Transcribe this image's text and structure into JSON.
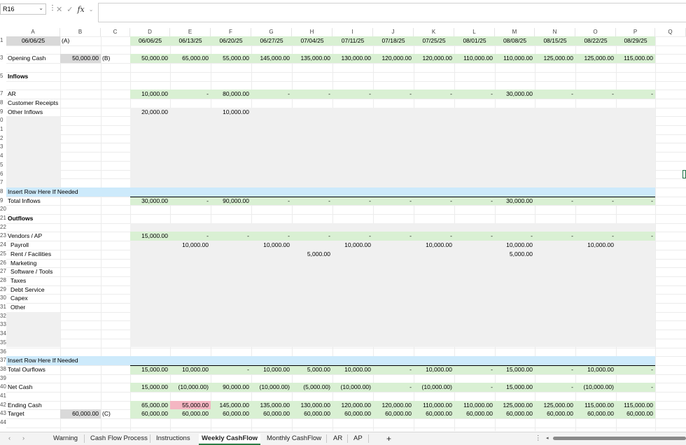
{
  "formula_bar": {
    "name_box": "R16",
    "fx_label": "fx",
    "value": ""
  },
  "columns": [
    "A",
    "B",
    "C",
    "D",
    "E",
    "F",
    "G",
    "H",
    "I",
    "J",
    "K",
    "L",
    "M",
    "N",
    "O",
    "P",
    "Q"
  ],
  "row_numbers": [
    "1",
    "",
    "3",
    "",
    "5",
    "",
    "7",
    "8",
    "9",
    "0",
    "1",
    "2",
    "3",
    "4",
    "5",
    "6",
    "7",
    "8",
    "9",
    "20",
    "21",
    "22",
    "23",
    "24",
    "25",
    "26",
    "27",
    "28",
    "29",
    "30",
    "31",
    "32",
    "33",
    "34",
    "35",
    "36",
    "37",
    "38",
    "39",
    "40",
    "41",
    "42",
    "43",
    "44"
  ],
  "a1": "06/06/25",
  "b1": "(A)",
  "dates": [
    "06/06/25",
    "06/13/25",
    "06/20/25",
    "06/27/25",
    "07/04/25",
    "07/11/25",
    "07/18/25",
    "07/25/25",
    "08/01/25",
    "08/08/25",
    "08/15/25",
    "08/22/25",
    "08/29/25"
  ],
  "opening_cash": {
    "label": "Opening Cash",
    "b": "50,000.00",
    "c": "(B)",
    "values": [
      "50,000.00",
      "65,000.00",
      "55,000.00",
      "145,000.00",
      "135,000.00",
      "130,000.00",
      "120,000.00",
      "120,000.00",
      "110,000.00",
      "110,000.00",
      "125,000.00",
      "125,000.00",
      "115,000.00"
    ]
  },
  "inflows_header": "Inflows",
  "ar": {
    "label": "AR",
    "values": [
      "10,000.00",
      "-",
      "80,000.00",
      "-",
      "-",
      "-",
      "-",
      "-",
      "-",
      "30,000.00",
      "-",
      "-",
      "-"
    ]
  },
  "customer_receipts": {
    "label": "Customer Receipts"
  },
  "other_inflows": {
    "label": "Other Inflows",
    "values": [
      "20,000.00",
      "",
      "10,000.00",
      "",
      "",
      "",
      "",
      "",
      "",
      "",
      "",
      "",
      ""
    ]
  },
  "insert_row_1": "Insert Row Here If Needed",
  "total_inflows": {
    "label": "Total Inflows",
    "values": [
      "30,000.00",
      "-",
      "90,000.00",
      "-",
      "-",
      "-",
      "-",
      "-",
      "-",
      "30,000.00",
      "-",
      "-",
      "-"
    ]
  },
  "outflows_header": "Outflows",
  "vendors": {
    "label": "Vendors / AP",
    "values": [
      "15,000.00",
      "-",
      "-",
      "-",
      "-",
      "-",
      "-",
      "-",
      "-",
      "-",
      "-",
      "-",
      "-"
    ]
  },
  "payroll": {
    "label": "Payroll",
    "values": [
      "",
      "10,000.00",
      "",
      "10,000.00",
      "",
      "10,000.00",
      "",
      "10,000.00",
      "",
      "10,000.00",
      "",
      "10,000.00",
      ""
    ]
  },
  "rent": {
    "label": "Rent / Facilities",
    "values": [
      "",
      "",
      "",
      "",
      "5,000.00",
      "",
      "",
      "",
      "",
      "5,000.00",
      "",
      "",
      ""
    ]
  },
  "outflow_labels": [
    "Marketing",
    "Software / Tools",
    "Taxes",
    "Debt Service",
    "Capex",
    "Other"
  ],
  "insert_row_2": "Insert Row Here If Needed",
  "total_outflows": {
    "label": "Total Ourflows",
    "values": [
      "15,000.00",
      "10,000.00",
      "-",
      "10,000.00",
      "5,000.00",
      "10,000.00",
      "-",
      "10,000.00",
      "-",
      "15,000.00",
      "-",
      "10,000.00",
      "-"
    ]
  },
  "net_cash": {
    "label": "Net Cash",
    "values": [
      "15,000.00",
      "(10,000.00)",
      "90,000.00",
      "(10,000.00)",
      "(5,000.00)",
      "(10,000.00)",
      "-",
      "(10,000.00)",
      "-",
      "15,000.00",
      "-",
      "(10,000.00)",
      "-"
    ]
  },
  "ending_cash": {
    "label": "Ending Cash",
    "values": [
      "65,000.00",
      "55,000.00",
      "145,000.00",
      "135,000.00",
      "130,000.00",
      "120,000.00",
      "120,000.00",
      "110,000.00",
      "110,000.00",
      "125,000.00",
      "125,000.00",
      "115,000.00",
      "115,000.00"
    ]
  },
  "target": {
    "label": "Target",
    "b": "60,000.00",
    "c": "(C)",
    "values": [
      "60,000.00",
      "60,000.00",
      "60,000.00",
      "60,000.00",
      "60,000.00",
      "60,000.00",
      "60,000.00",
      "60,000.00",
      "60,000.00",
      "60,000.00",
      "60,000.00",
      "60,000.00",
      "60,000.00"
    ]
  },
  "sheet_tabs": [
    "Warning",
    "Cash Flow Process",
    "Instructions",
    "Weekly CashFlow",
    "Monthly CashFlow",
    "AR",
    "AP"
  ],
  "active_tab": "Weekly CashFlow",
  "colors": {
    "green_fill": "#d9f0d3",
    "blue_fill": "#cdeafb",
    "gray_fill": "#f0f0f0",
    "input_gray": "#d9d9d9",
    "red_fill": "#f4b6c2",
    "active_tab_underline": "#2d7d46"
  }
}
